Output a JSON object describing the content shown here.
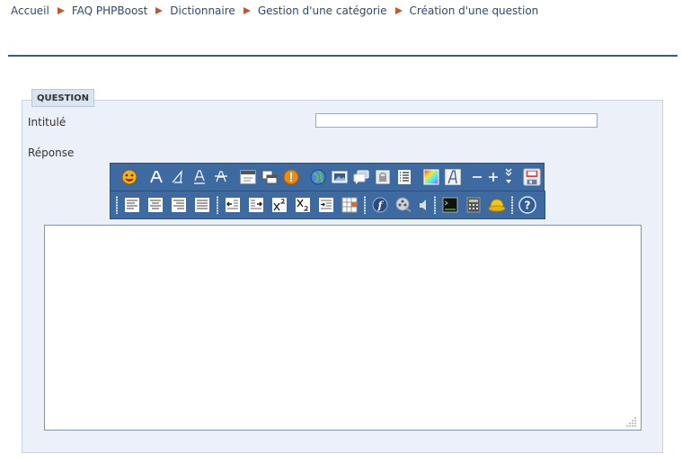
{
  "breadcrumb": {
    "items": [
      "Accueil",
      "FAQ PHPBoost",
      "Dictionnaire",
      "Gestion d'une catégorie",
      "Création d'une question"
    ]
  },
  "form": {
    "legend": "QUESTION",
    "title_label": "Intitulé",
    "title_value": "",
    "answer_label": "Réponse",
    "answer_value": ""
  },
  "toolbar": {
    "row1_icons": [
      "smiley-icon",
      "bold-icon",
      "italic-icon",
      "underline-icon",
      "strike-icon",
      "title-icon",
      "container-icon",
      "warning-icon",
      "url-icon",
      "image-icon",
      "quote-icon",
      "hide-icon",
      "list-icon",
      "color-icon",
      "font-size-icon",
      "minus-icon",
      "plus-icon",
      "more-icon",
      "save-icon"
    ],
    "row2_icons": [
      "align-left-icon",
      "align-center-icon",
      "align-right-icon",
      "justify-icon",
      "float-left-icon",
      "float-right-icon",
      "superscript-icon",
      "subscript-icon",
      "indent-icon",
      "table-icon",
      "flash-icon",
      "movie-icon",
      "sound-icon",
      "code-icon",
      "math-icon",
      "anchor-icon",
      "help-icon"
    ]
  },
  "colors": {
    "accent": "#3a5a8c",
    "breadcrumb_arrow": "#c8542a",
    "toolbar_bg": "#3d6aa0",
    "panel_bg": "#ecf0f8"
  }
}
